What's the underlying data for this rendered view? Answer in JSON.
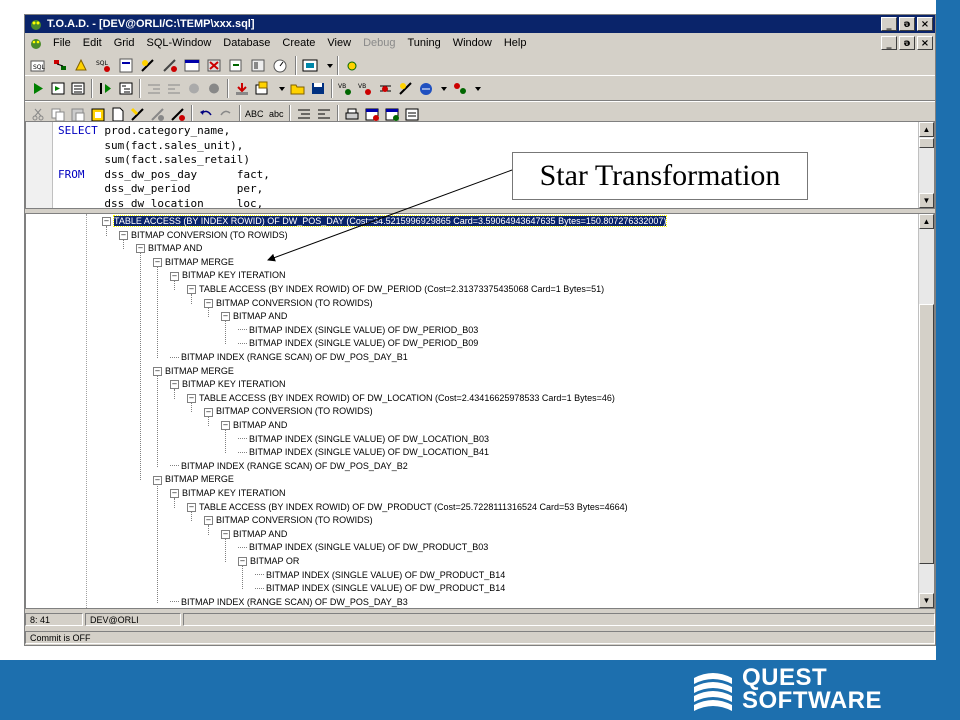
{
  "window": {
    "title": "T.O.A.D. - [DEV@ORLI/C:\\TEMP\\xxx.sql]"
  },
  "menu": [
    {
      "label": "File",
      "disabled": false
    },
    {
      "label": "Edit",
      "disabled": false
    },
    {
      "label": "Grid",
      "disabled": false
    },
    {
      "label": "SQL-Window",
      "disabled": false
    },
    {
      "label": "Database",
      "disabled": false
    },
    {
      "label": "Create",
      "disabled": false
    },
    {
      "label": "View",
      "disabled": false
    },
    {
      "label": "Debug",
      "disabled": true
    },
    {
      "label": "Tuning",
      "disabled": false
    },
    {
      "label": "Window",
      "disabled": false
    },
    {
      "label": "Help",
      "disabled": false
    }
  ],
  "window_buttons": {
    "minimize": "_",
    "restore": "ə",
    "close": "×"
  },
  "toolbar": {
    "abc_upper": "ABC",
    "abc_lower": "abc"
  },
  "sql": {
    "lines": [
      {
        "kw": "SELECT",
        "text": " prod.category_name,"
      },
      {
        "kw": "",
        "text": "       sum(fact.sales_unit),"
      },
      {
        "kw": "",
        "text": "       sum(fact.sales_retail)"
      },
      {
        "kw": "FROM",
        "text": "   dss_dw_pos_day      fact,"
      },
      {
        "kw": "",
        "text": "       dss_dw_period       per,"
      },
      {
        "kw": "",
        "text": "       dss_dw_location     loc,"
      }
    ]
  },
  "plan": {
    "nodes": [
      {
        "level": 0,
        "label": "TABLE ACCESS (BY INDEX ROWID) OF DW_POS_DAY (Cost=34.5215996929865 Card=3.59064943647635 Bytes=150.807276332007)",
        "expandable": true,
        "selected": true
      },
      {
        "level": 1,
        "label": "BITMAP CONVERSION (TO ROWIDS)",
        "expandable": true
      },
      {
        "level": 2,
        "label": "BITMAP AND",
        "expandable": true
      },
      {
        "level": 3,
        "label": "BITMAP MERGE",
        "expandable": true
      },
      {
        "level": 4,
        "label": "BITMAP KEY ITERATION",
        "expandable": true
      },
      {
        "level": 5,
        "label": "TABLE ACCESS (BY INDEX ROWID) OF DW_PERIOD (Cost=2.31373375435068 Card=1 Bytes=51)",
        "expandable": true
      },
      {
        "level": 6,
        "label": "BITMAP CONVERSION (TO ROWIDS)",
        "expandable": true
      },
      {
        "level": 7,
        "label": "BITMAP AND",
        "expandable": true
      },
      {
        "level": 8,
        "label": "BITMAP INDEX (SINGLE VALUE) OF DW_PERIOD_B03",
        "expandable": false
      },
      {
        "level": 8,
        "label": "BITMAP INDEX (SINGLE VALUE) OF DW_PERIOD_B09",
        "expandable": false
      },
      {
        "level": 4,
        "label": "BITMAP INDEX (RANGE SCAN) OF DW_POS_DAY_B1",
        "expandable": false
      },
      {
        "level": 3,
        "label": "BITMAP MERGE",
        "expandable": true
      },
      {
        "level": 4,
        "label": "BITMAP KEY ITERATION",
        "expandable": true
      },
      {
        "level": 5,
        "label": "TABLE ACCESS (BY INDEX ROWID) OF DW_LOCATION (Cost=2.43416625978533 Card=1 Bytes=46)",
        "expandable": true
      },
      {
        "level": 6,
        "label": "BITMAP CONVERSION (TO ROWIDS)",
        "expandable": true
      },
      {
        "level": 7,
        "label": "BITMAP AND",
        "expandable": true
      },
      {
        "level": 8,
        "label": "BITMAP INDEX (SINGLE VALUE) OF DW_LOCATION_B03",
        "expandable": false
      },
      {
        "level": 8,
        "label": "BITMAP INDEX (SINGLE VALUE) OF DW_LOCATION_B41",
        "expandable": false
      },
      {
        "level": 4,
        "label": "BITMAP INDEX (RANGE SCAN) OF DW_POS_DAY_B2",
        "expandable": false
      },
      {
        "level": 3,
        "label": "BITMAP MERGE",
        "expandable": true
      },
      {
        "level": 4,
        "label": "BITMAP KEY ITERATION",
        "expandable": true
      },
      {
        "level": 5,
        "label": "TABLE ACCESS (BY INDEX ROWID) OF DW_PRODUCT (Cost=25.7228111316524 Card=53 Bytes=4664)",
        "expandable": true
      },
      {
        "level": 6,
        "label": "BITMAP CONVERSION (TO ROWIDS)",
        "expandable": true
      },
      {
        "level": 7,
        "label": "BITMAP AND",
        "expandable": true
      },
      {
        "level": 8,
        "label": "BITMAP INDEX (SINGLE VALUE) OF DW_PRODUCT_B03",
        "expandable": false
      },
      {
        "level": 8,
        "label": "BITMAP OR",
        "expandable": true
      },
      {
        "level": 9,
        "label": "BITMAP INDEX (SINGLE VALUE) OF DW_PRODUCT_B14",
        "expandable": false
      },
      {
        "level": 9,
        "label": "BITMAP INDEX (SINGLE VALUE) OF DW_PRODUCT_B14",
        "expandable": false
      },
      {
        "level": 4,
        "label": "BITMAP INDEX (RANGE SCAN) OF DW_POS_DAY_B3",
        "expandable": false
      }
    ]
  },
  "status": {
    "position": "8:  41",
    "connection": "DEV@ORLI",
    "commit": "Commit is OFF"
  },
  "callout": {
    "text": "Star Transformation"
  },
  "logo": {
    "line1": "QUEST",
    "line2": "SOFTWARE"
  },
  "colors": {
    "slide_band": "#1d6fae",
    "title_bar": "#0a246a",
    "keyword": "#0000c0",
    "selection": "#0a246a"
  }
}
